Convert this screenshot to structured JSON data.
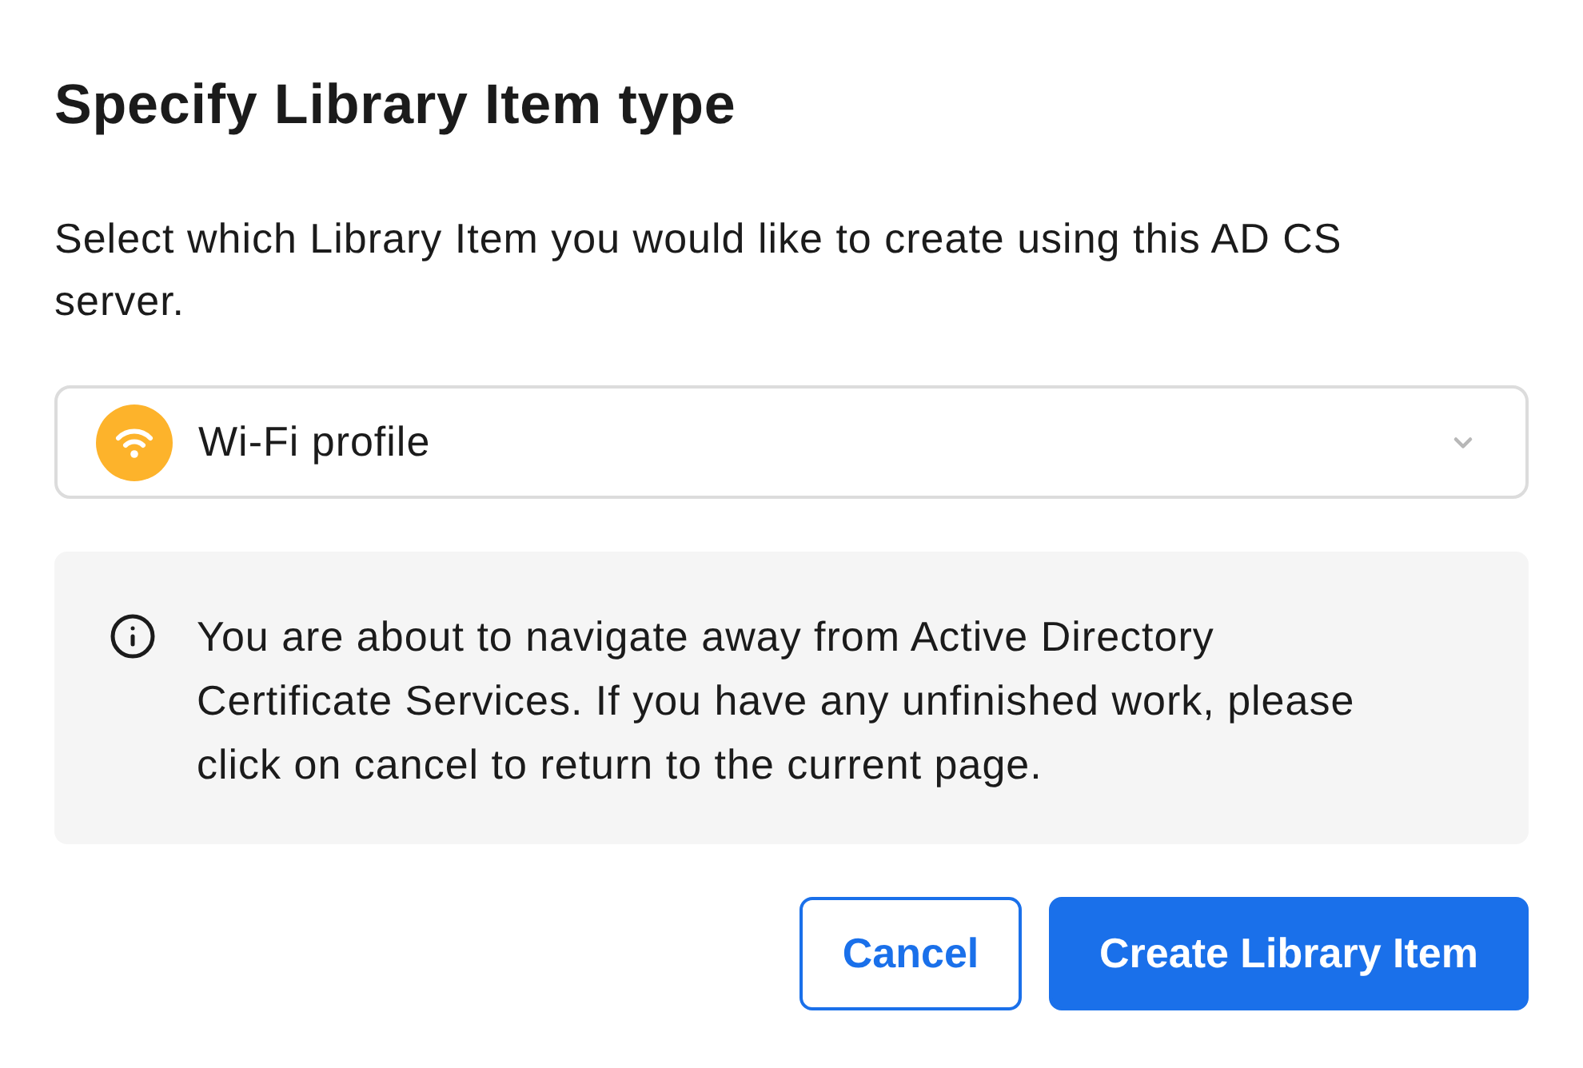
{
  "dialog": {
    "title": "Specify Library Item type",
    "description": "Select which Library Item you would like to create using this AD CS server."
  },
  "select": {
    "value": "Wi-Fi profile"
  },
  "notice": {
    "text": "You are about to navigate away from Active Directory Certificate Services. If you have any unfinished work, please click on cancel to return to the current page."
  },
  "buttons": [
    {
      "label": "Cancel",
      "kind": "secondary"
    },
    {
      "label": "Create Library Item",
      "kind": "primary"
    }
  ]
}
